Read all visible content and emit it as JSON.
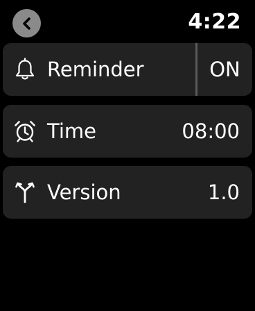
{
  "status_bar": {
    "time": "4:22"
  },
  "rows": [
    {
      "icon": "bell-icon",
      "label": "Reminder",
      "value": "ON"
    },
    {
      "icon": "alarm-clock-icon",
      "label": "Time",
      "value": "08:00"
    },
    {
      "icon": "branch-icon",
      "label": "Version",
      "value": "1.0"
    }
  ],
  "colors": {
    "background": "#000000",
    "row_background": "#222222",
    "back_button": "#8a8a8a",
    "text": "#ffffff"
  }
}
